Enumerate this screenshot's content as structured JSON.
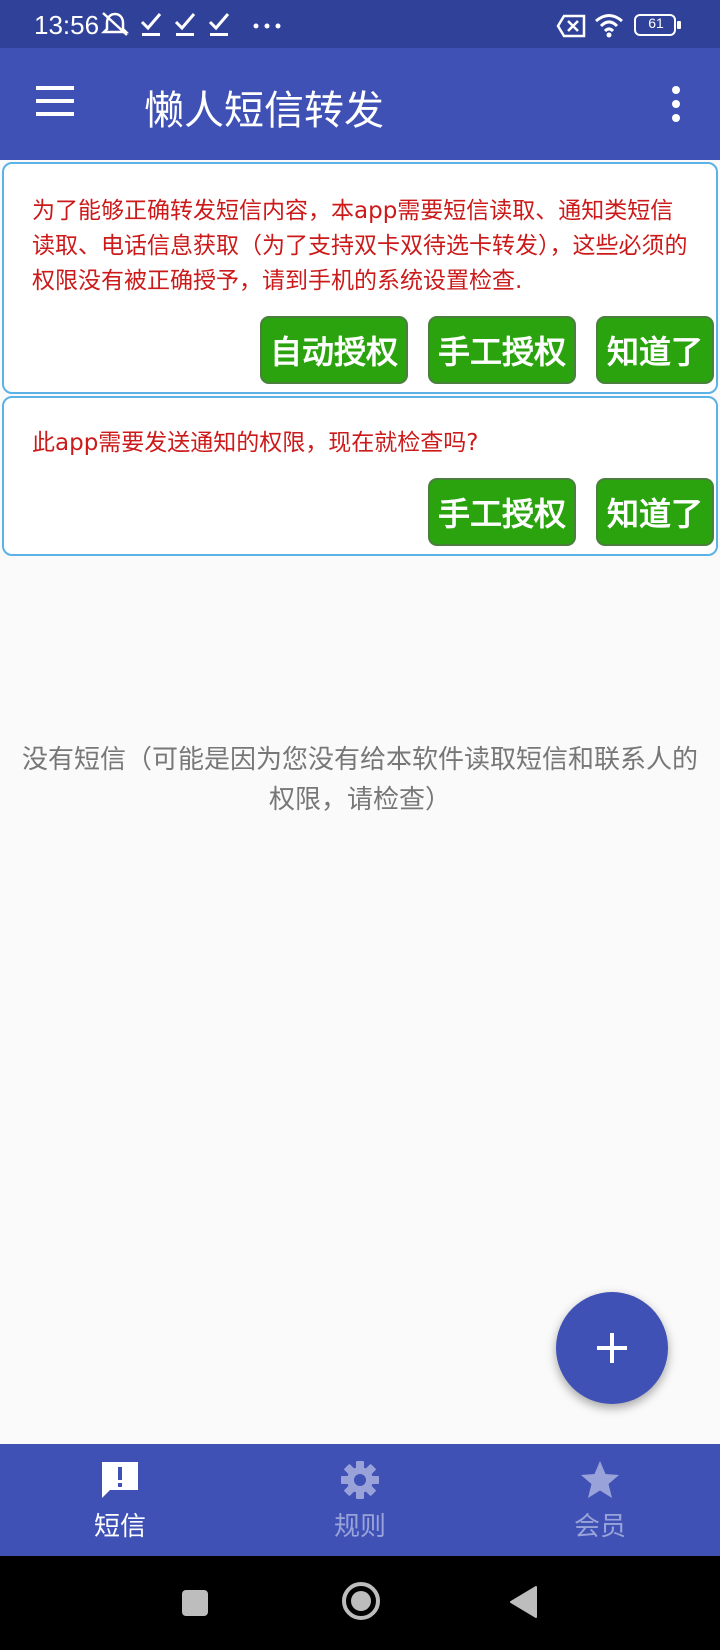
{
  "status_bar": {
    "time": "13:56",
    "battery": "61",
    "left_icons": [
      "no-notification-icon",
      "check-icon",
      "check-icon",
      "check-icon",
      "more-dots-icon"
    ],
    "right_icons": [
      "sim-x-icon",
      "wifi-icon",
      "battery-icon"
    ]
  },
  "app_bar": {
    "title": "懒人短信转发",
    "menu_icon": "menu-icon",
    "more_icon": "more-vert-icon",
    "color": "#3f51b5"
  },
  "cards": [
    {
      "message": "为了能够正确转发短信内容，本app需要短信读取、通知类短信读取、电话信息获取（为了支持双卡双待选卡转发），这些必须的权限没有被正确授予，请到手机的系统设置检查.",
      "buttons": [
        "自动授权",
        "手工授权",
        "知道了"
      ]
    },
    {
      "message": "此app需要发送通知的权限，现在就检查吗?",
      "buttons": [
        "手工授权",
        "知道了"
      ]
    }
  ],
  "empty_state": {
    "message": "没有短信（可能是因为您没有给本软件读取短信和联系人的权限，请检查）"
  },
  "fab": {
    "icon": "plus-icon"
  },
  "bottom_nav": {
    "items": [
      {
        "label": "短信",
        "icon": "message-alert-icon",
        "active": true
      },
      {
        "label": "规则",
        "icon": "gear-icon",
        "active": false
      },
      {
        "label": "会员",
        "icon": "star-icon",
        "active": false
      }
    ]
  },
  "colors": {
    "primary": "#3f51b5",
    "status_bar": "#2f4199",
    "button_green": "#2aa30e",
    "warning_text": "#cc1a1a",
    "card_border": "#5ab2e6"
  }
}
